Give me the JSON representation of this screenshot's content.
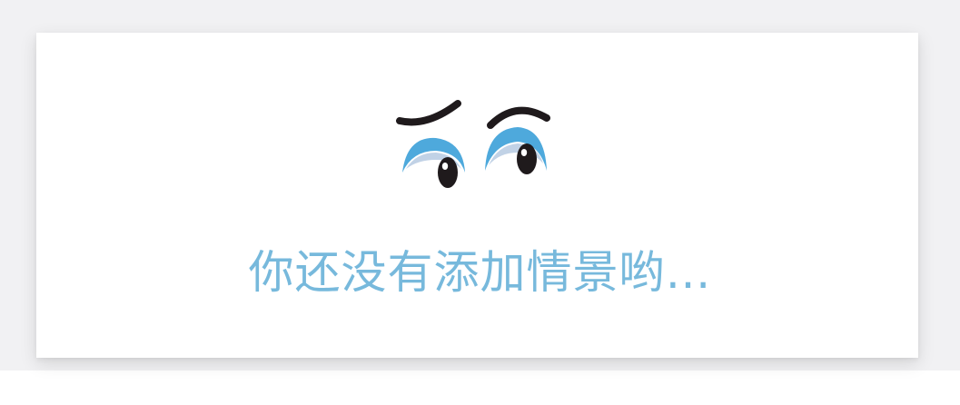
{
  "empty_state": {
    "message": "你还没有添加情景哟…",
    "illustration_icon": "eyes-icon"
  },
  "colors": {
    "backdrop": "#f1f1f3",
    "card": "#ffffff",
    "message_text": "#77b9dc",
    "eye_blue": "#4ea9dc",
    "eye_light": "#c1d2e6",
    "brow_and_pupil": "#1f1a1c"
  }
}
